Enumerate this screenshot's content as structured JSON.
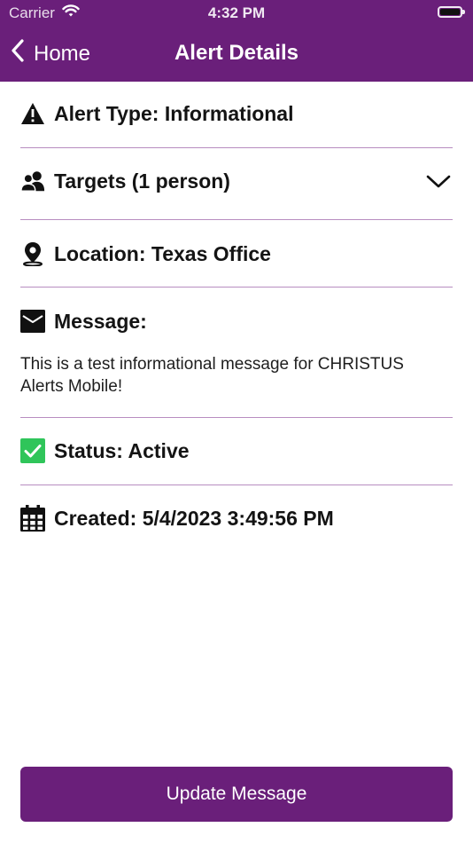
{
  "status_bar": {
    "carrier": "Carrier",
    "time": "4:32 PM"
  },
  "nav": {
    "back_label": "Home",
    "title": "Alert Details"
  },
  "details": {
    "alert_type": "Alert Type: Informational",
    "targets": "Targets (1 person)",
    "location": "Location: Texas Office",
    "message_label": "Message:",
    "message_text": "This is a test informational message for CHRISTUS Alerts Mobile!",
    "status": "Status: Active",
    "created": "Created: 5/4/2023 3:49:56 PM"
  },
  "actions": {
    "update_label": "Update Message"
  },
  "icons": {
    "alert_type": "warning-icon",
    "targets": "people-icon",
    "location": "location-pin-icon",
    "message": "envelope-icon",
    "status": "checkbox-checked-icon",
    "created": "calendar-icon",
    "expand": "chevron-down-icon",
    "back": "chevron-left-icon"
  },
  "colors": {
    "brand_purple": "#6a1f7a",
    "divider": "#b88dc0",
    "status_green": "#2fc55a"
  }
}
